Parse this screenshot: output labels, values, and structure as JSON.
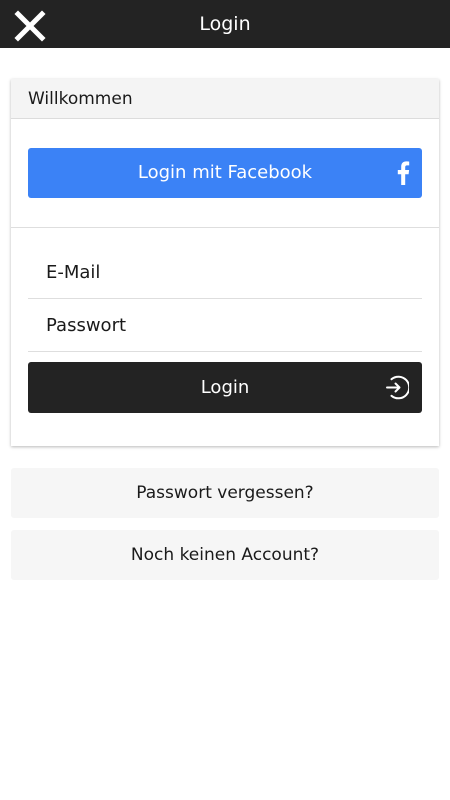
{
  "topbar": {
    "title": "Login",
    "close_icon": "close-icon"
  },
  "card": {
    "header": "Willkommen",
    "facebook_button": {
      "label": "Login mit Facebook",
      "icon": "facebook-icon",
      "color": "#3b82f6"
    },
    "email_field": {
      "placeholder": "E-Mail",
      "value": ""
    },
    "password_field": {
      "placeholder": "Passwort",
      "value": ""
    },
    "login_button": {
      "label": "Login",
      "icon": "sign-in-icon",
      "color": "#232323"
    }
  },
  "links": {
    "forgot_password": "Passwort vergessen?",
    "no_account": "Noch keinen Account?"
  },
  "colors": {
    "topbar_bg": "#232323",
    "link_bg": "#f6f6f6"
  }
}
